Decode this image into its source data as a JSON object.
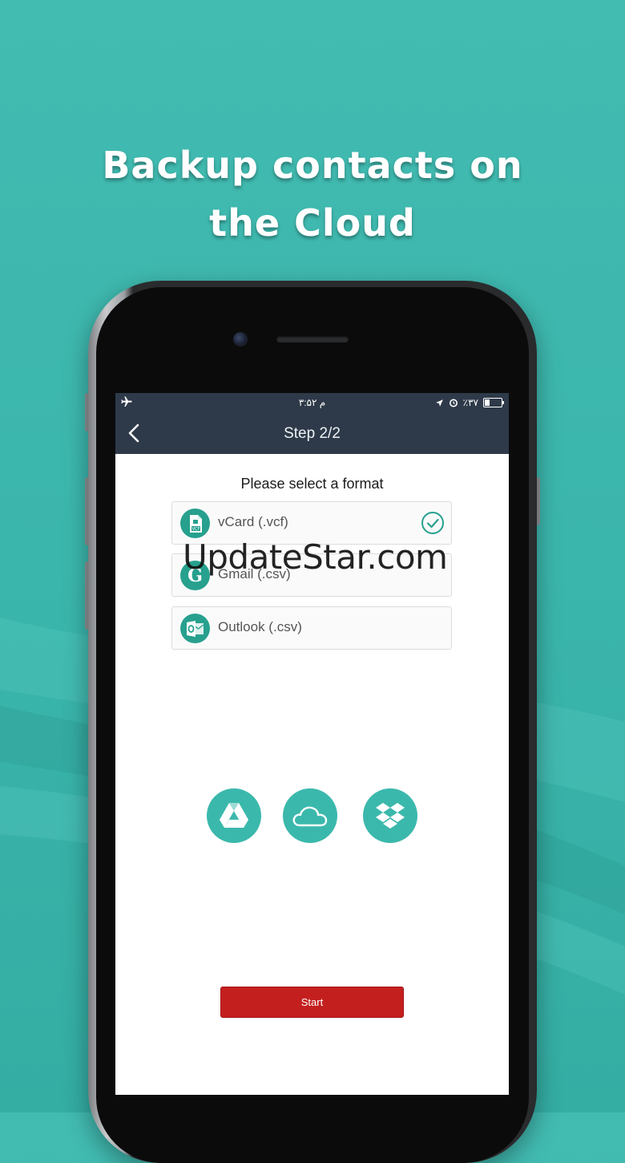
{
  "headline": {
    "line1": "Backup contacts on",
    "line2": "the Cloud"
  },
  "status_bar": {
    "time": "۳:۵۲ م",
    "battery": "٪۳۷",
    "icons": [
      "airplane-icon",
      "location-icon",
      "alarm-icon",
      "battery-icon"
    ]
  },
  "nav": {
    "title": "Step 2/2",
    "back_icon": "chevron-left-icon"
  },
  "prompt": "Please select a format",
  "formats": [
    {
      "label": "vCard (.vcf)",
      "icon": "vcard-file-icon",
      "selected": true
    },
    {
      "label": "Gmail (.csv)",
      "icon": "google-g-icon",
      "selected": false
    },
    {
      "label": "Outlook (.csv)",
      "icon": "outlook-icon",
      "selected": false
    }
  ],
  "cloud_services": [
    {
      "name": "google-drive-icon"
    },
    {
      "name": "icloud-icon"
    },
    {
      "name": "dropbox-icon"
    }
  ],
  "start_label": "Start",
  "watermark": "UpdateStar.com",
  "colors": {
    "background": "#3bb6ac",
    "navbar": "#2e3a49",
    "accent": "#27a08e",
    "start": "#c41f1f"
  }
}
